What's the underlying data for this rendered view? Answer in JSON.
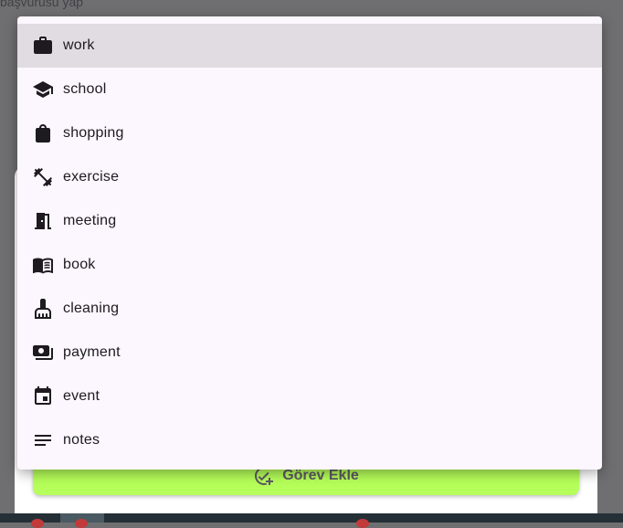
{
  "background": {
    "partial_text": "başvurusu yap",
    "add_task_label": "Görev Ekle"
  },
  "menu": {
    "items": [
      {
        "label": "work",
        "icon": "briefcase-icon",
        "selected": true
      },
      {
        "label": "school",
        "icon": "school-icon"
      },
      {
        "label": "shopping",
        "icon": "shopping-bag-icon"
      },
      {
        "label": "exercise",
        "icon": "dumbbell-icon"
      },
      {
        "label": "meeting",
        "icon": "door-icon"
      },
      {
        "label": "book",
        "icon": "book-icon"
      },
      {
        "label": "cleaning",
        "icon": "broom-icon"
      },
      {
        "label": "payment",
        "icon": "payment-icon"
      },
      {
        "label": "event",
        "icon": "calendar-event-icon"
      },
      {
        "label": "notes",
        "icon": "notes-icon"
      }
    ]
  },
  "colors": {
    "menu_bg": "#fcf6fe",
    "selected_bg": "#e0dce1",
    "add_button": "#b6ff5a",
    "scrim": "#6f6f71"
  }
}
